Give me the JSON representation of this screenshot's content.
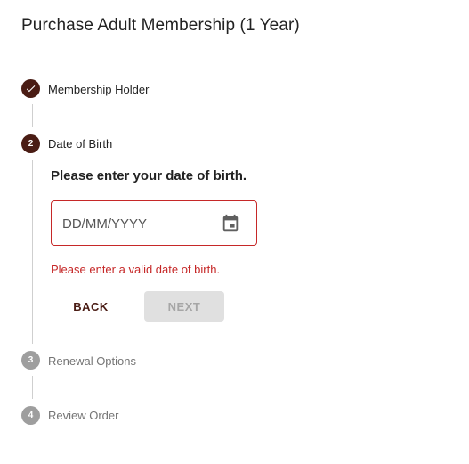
{
  "page": {
    "title": "Purchase Adult Membership (1 Year)"
  },
  "stepper": {
    "steps": [
      {
        "number": "",
        "label": "Membership Holder",
        "state": "completed",
        "icon": "check-icon"
      },
      {
        "number": "2",
        "label": "Date of Birth",
        "state": "active"
      },
      {
        "number": "3",
        "label": "Renewal Options",
        "state": "pending"
      },
      {
        "number": "4",
        "label": "Review Order",
        "state": "pending"
      }
    ]
  },
  "dob_form": {
    "prompt": "Please enter your date of birth.",
    "date_input": {
      "value": "",
      "placeholder": "DD/MM/YYYY"
    },
    "calendar_icon": "calendar-icon",
    "error_message": "Please enter a valid date of birth.",
    "back_label": "BACK",
    "next_label": "NEXT",
    "next_enabled": false
  },
  "colors": {
    "accent": "#4a1c14",
    "error": "#c62828",
    "pending": "#9e9e9e",
    "disabled_button_bg": "#e0e0e0"
  }
}
